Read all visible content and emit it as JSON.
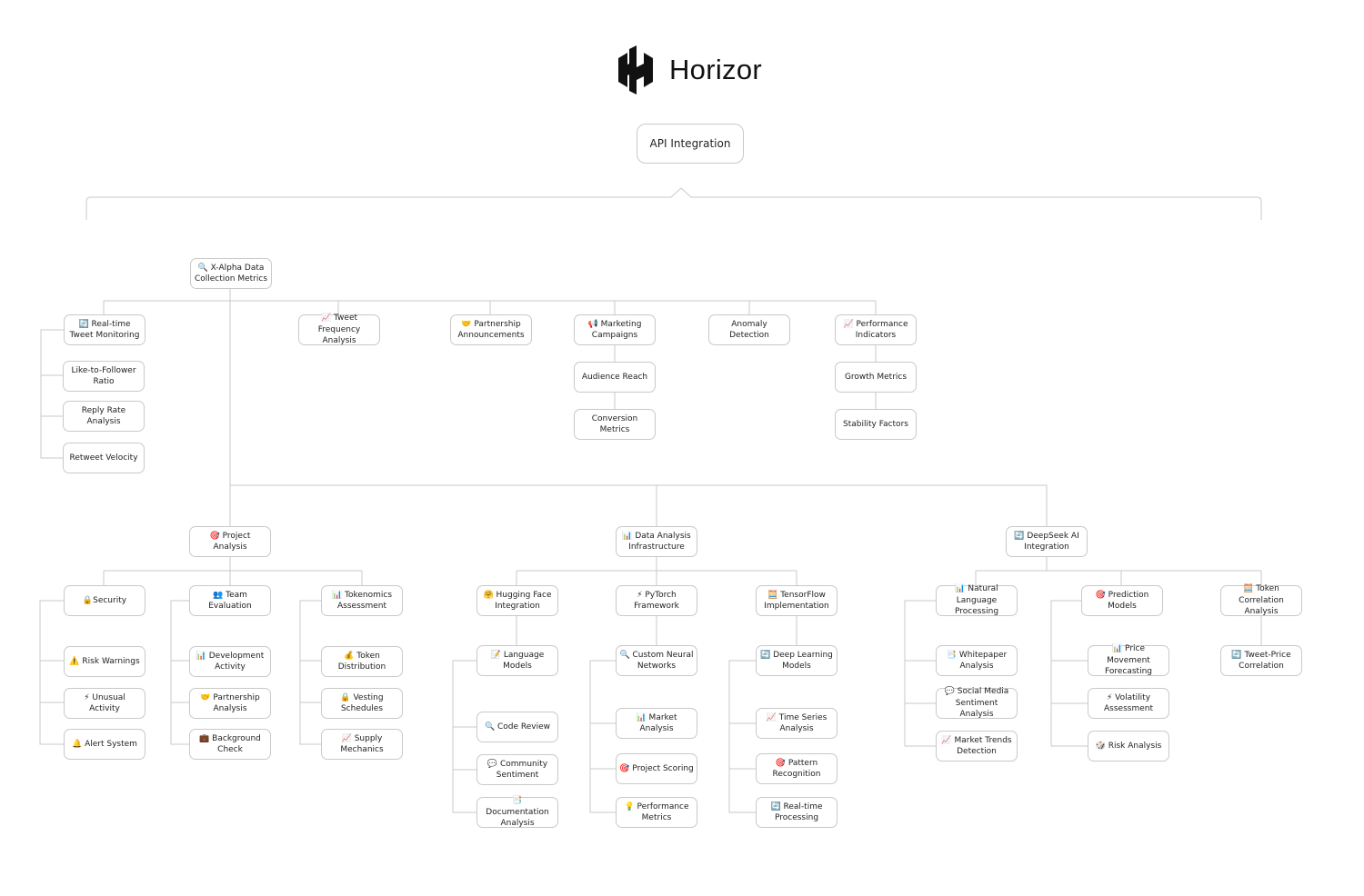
{
  "logo": {
    "text": "Horizor",
    "icon": "horizor-logo-icon"
  },
  "root": "API Integration",
  "nodes": {
    "xalpha": "🔍 X-Alpha Data Collection Metrics",
    "realtime_tweet": "🔄 Real-time Tweet Monitoring",
    "like_follower": "Like-to-Follower Ratio",
    "reply_rate": "Reply Rate Analysis",
    "retweet_velocity": "Retweet Velocity",
    "tweet_frequency": "📈 Tweet Frequency Analysis",
    "partnership_ann": "🤝 Partnership Announcements",
    "marketing": "📢 Marketing Campaigns",
    "audience_reach": "Audience Reach",
    "conversion": "Conversion Metrics",
    "anomaly": "Anomaly Detection",
    "performance_ind": "📈 Performance Indicators",
    "growth": "Growth Metrics",
    "stability": "Stability Factors",
    "project_analysis": "🎯 Project Analysis",
    "security": "🔒Security",
    "risk_warnings": "⚠️ Risk Warnings",
    "unusual_activity": "⚡ Unusual Activity",
    "alert_system": "🔔 Alert System",
    "team_eval": "👥 Team Evaluation",
    "dev_activity": "📊 Development Activity",
    "partnership_analysis": "🤝 Partnership Analysis",
    "background_check": "💼 Background Check",
    "tokenomics": "📊 Tokenomics Assessment",
    "token_distribution": "💰 Token Distribution",
    "vesting": "🔒 Vesting Schedules",
    "supply": "📈 Supply Mechanics",
    "data_infra": "📊 Data Analysis Infrastructure",
    "hugging_face": "🤗 Hugging Face Integration",
    "language_models": "📝 Language Models",
    "code_review": "🔍 Code Review",
    "community_sentiment": "💬 Community Sentiment",
    "documentation": "📑 Documentation Analysis",
    "pytorch": "⚡ PyTorch Framework",
    "custom_nn": "🔍 Custom Neural Networks",
    "market_analysis": "📊 Market Analysis",
    "project_scoring": "🎯 Project Scoring",
    "perf_metrics": "💡 Performance Metrics",
    "tensorflow": "🧮 TensorFlow Implementation",
    "deep_learning": "🔄 Deep Learning Models",
    "time_series": "📈 Time Series Analysis",
    "pattern_recognition": "🎯 Pattern Recognition",
    "realtime_processing": "🔄 Real-time Processing",
    "deepseek": "🔄 DeepSeek AI Integration",
    "nlp": "📊 Natural Language Processing",
    "whitepaper": "📑 Whitepaper Analysis",
    "social_sentiment": "💬 Social Media Sentiment Analysis",
    "market_trends": "📈 Market Trends Detection",
    "prediction": "🎯 Prediction Models",
    "price_movement": "📊 Price Movement Forecasting",
    "volatility": "⚡ Volatility Assessment",
    "risk_analysis": "🎲 Risk Analysis",
    "token_correlation": "🧮 Token Correlation Analysis",
    "tweet_price": "🔄 Tweet-Price Correlation"
  }
}
